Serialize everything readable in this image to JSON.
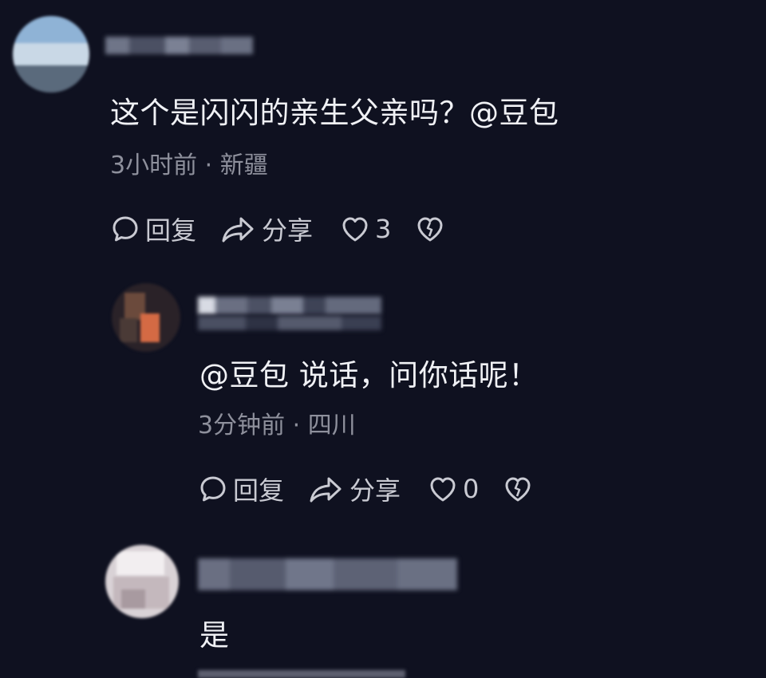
{
  "comments": [
    {
      "text": "这个是闪闪的亲生父亲吗？@豆包",
      "time": "3小时前",
      "location": "新疆",
      "reply_label": "回复",
      "share_label": "分享",
      "like_count": "3"
    },
    {
      "text": "@豆包 说话，问你话呢！",
      "time": "3分钟前",
      "location": "四川",
      "reply_label": "回复",
      "share_label": "分享",
      "like_count": "0"
    },
    {
      "text": "是"
    }
  ],
  "colors": {
    "background": "#0f1120",
    "text": "#f0f1f5",
    "meta": "#8e909c",
    "action": "#c9cad2"
  },
  "icons": {
    "reply": "speech-bubble-icon",
    "share": "share-arrow-icon",
    "like": "heart-icon",
    "dislike": "broken-heart-icon"
  }
}
